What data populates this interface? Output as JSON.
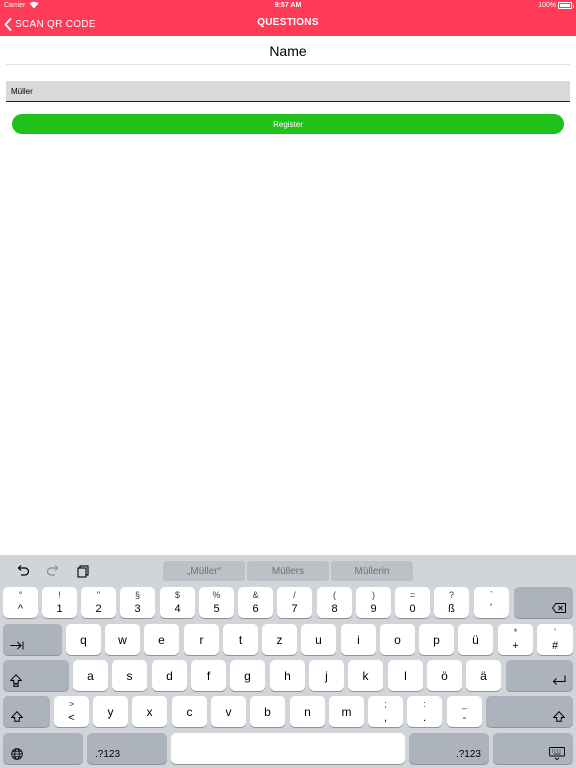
{
  "status_bar": {
    "carrier": "Carrier",
    "wifi_icon": "wifi-icon",
    "time": "9:57 AM",
    "battery_percent": "100%",
    "battery_level": 1.0
  },
  "nav": {
    "back_label": "SCAN QR CODE",
    "title": "QUESTIONS"
  },
  "form": {
    "question_label": "Name",
    "name_value": "Müller",
    "register_label": "Register"
  },
  "colors": {
    "nav_background": "#ff3b58",
    "register_button": "#21c11c",
    "keyboard_background": "#d1d4d9"
  },
  "keyboard": {
    "toolbar_icons": [
      "undo-icon",
      "redo-icon",
      "paste-icon"
    ],
    "suggestions": [
      "„Müller“",
      "Müllers",
      "Müllerin"
    ],
    "row1": [
      {
        "top": "°",
        "bottom": "^"
      },
      {
        "top": "!",
        "bottom": "1"
      },
      {
        "top": "\"",
        "bottom": "2"
      },
      {
        "top": "§",
        "bottom": "3"
      },
      {
        "top": "$",
        "bottom": "4"
      },
      {
        "top": "%",
        "bottom": "5"
      },
      {
        "top": "&",
        "bottom": "6"
      },
      {
        "top": "/",
        "bottom": "7"
      },
      {
        "top": "(",
        "bottom": "8"
      },
      {
        "top": ")",
        "bottom": "9"
      },
      {
        "top": "=",
        "bottom": "0"
      },
      {
        "top": "?",
        "bottom": "ß"
      },
      {
        "top": "`",
        "bottom": "´"
      }
    ],
    "row2": [
      "q",
      "w",
      "e",
      "r",
      "t",
      "z",
      "u",
      "i",
      "o",
      "p",
      "ü"
    ],
    "row2_extra": [
      {
        "top": "*",
        "bottom": "+"
      },
      {
        "top": "’",
        "bottom": "#"
      }
    ],
    "row3": [
      "a",
      "s",
      "d",
      "f",
      "g",
      "h",
      "j",
      "k",
      "l",
      "ö",
      "ä"
    ],
    "row4_first": {
      "top": ">",
      "bottom": "<"
    },
    "row4": [
      "y",
      "x",
      "c",
      "v",
      "b",
      "n",
      "m"
    ],
    "row4_punct": [
      {
        "top": ";",
        "bottom": ","
      },
      {
        "top": ":",
        "bottom": "."
      },
      {
        "top": "_",
        "bottom": "-"
      }
    ],
    "numbers_label": ".?123",
    "icons": {
      "delete": "delete-icon",
      "tab": "tab-icon",
      "caps_lock": "caps-lock-icon",
      "return": "return-icon",
      "shift": "shift-icon",
      "globe": "globe-icon",
      "dismiss": "keyboard-dismiss-icon"
    }
  }
}
